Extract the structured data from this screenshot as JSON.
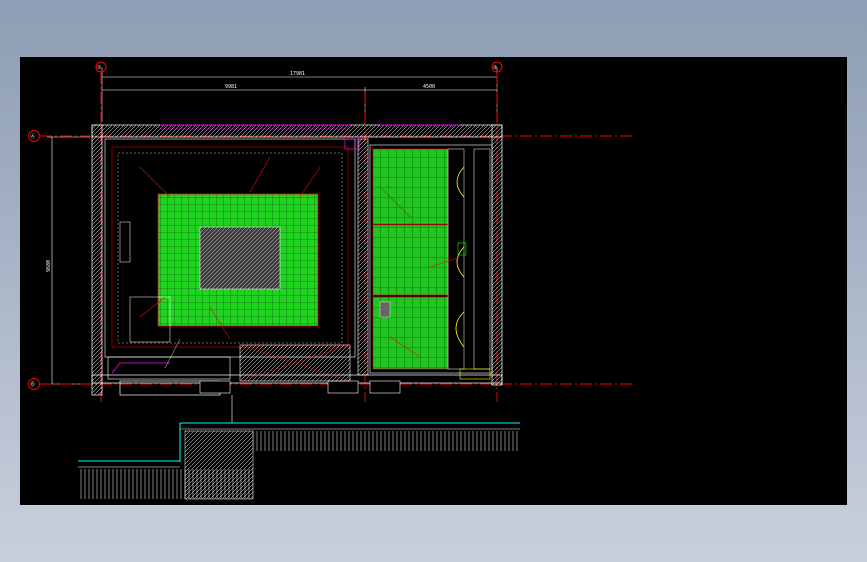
{
  "drawing": {
    "grid_labels": {
      "top_left": "①",
      "top_right": "②",
      "left_top": "Ⓐ",
      "left_bottom": "Ⓑ"
    },
    "dimensions": {
      "overall_width": "17981",
      "left_bay": "9981",
      "right_bay": "4500",
      "overall_height": "9680"
    },
    "colors": {
      "background": "#000000",
      "wall": "#ffffff",
      "grid_line": "#ff0000",
      "ceiling_grid": "#00ff00",
      "tag": "#ff00ff",
      "furniture": "#ffff00",
      "site_line": "#00ffff"
    }
  }
}
